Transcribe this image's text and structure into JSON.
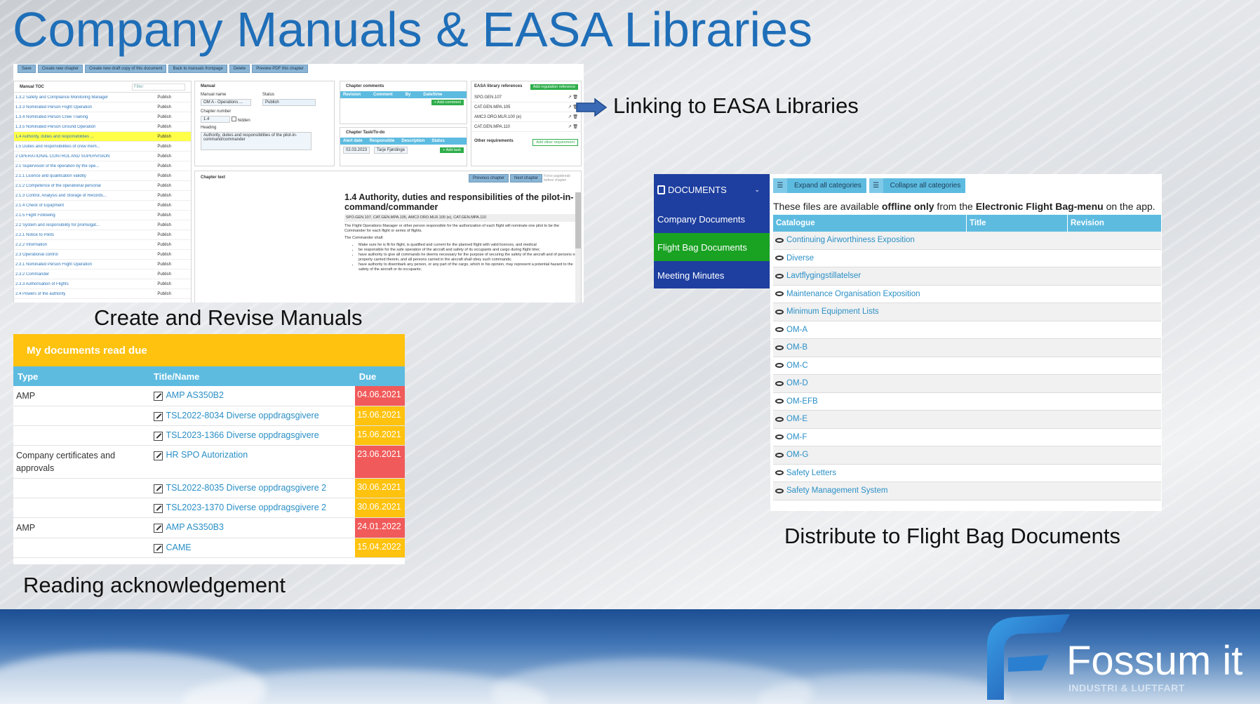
{
  "page": {
    "title": "Company Manuals & EASA Libraries",
    "captions": {
      "linking": "Linking to EASA Libraries",
      "create": "Create and Revise Manuals",
      "distribute": "Distribute to Flight Bag Documents",
      "reading": "Reading acknowledgement"
    }
  },
  "editor": {
    "toolbar": [
      "Save",
      "Create new chapter",
      "Create new draft copy of this document",
      "Back to manuals frontpage",
      "Delete",
      "Preview PDF this chapter"
    ],
    "toc": {
      "title": "Manual TOC",
      "filter": "Filter",
      "rows": [
        {
          "t": "1.3.2 Safety and Compliance Monitoring Manager",
          "s": "Publish"
        },
        {
          "t": "1.3.3 Nominated Person Flight Operation",
          "s": "Publish"
        },
        {
          "t": "1.3.4 Nominated Person Crew Training",
          "s": "Publish"
        },
        {
          "t": "1.3.5 Nominated Person Ground Operation",
          "s": "Publish"
        },
        {
          "t": "1.4 Authority, duties and responsibilities ...",
          "s": "Publish"
        },
        {
          "t": "1.5 Duties and responsibilities of crew mem...",
          "s": "Publish"
        },
        {
          "t": "2 OPERATIONAL CONTROL AND SUPERVISION",
          "s": "Publish"
        },
        {
          "t": "2.1 Supervision of the operation by the ope...",
          "s": "Publish"
        },
        {
          "t": "2.1.1 Licence and qualification validity",
          "s": "Publish"
        },
        {
          "t": "2.1.2 Competence of the operational personal",
          "s": "Publish"
        },
        {
          "t": "2.1.3 Control, Analysis and Storage of Records...",
          "s": "Publish"
        },
        {
          "t": "2.1.4 Check of Equipment",
          "s": "Publish"
        },
        {
          "t": "2.1.5 Flight Following",
          "s": "Publish"
        },
        {
          "t": "2.2 System and responsibility for promulgat...",
          "s": "Publish"
        },
        {
          "t": "2.2.1 Notice to Pilots",
          "s": "Publish"
        },
        {
          "t": "2.2.2 Information",
          "s": "Publish"
        },
        {
          "t": "2.3 Operational control",
          "s": "Publish"
        },
        {
          "t": "2.3.1 Nominated Person Flight Operation",
          "s": "Publish"
        },
        {
          "t": "2.3.2 Commander",
          "s": "Publish"
        },
        {
          "t": "2.3.3 Authorisation of Flights",
          "s": "Publish"
        },
        {
          "t": "2.4 Powers of the authority",
          "s": "Publish"
        }
      ]
    },
    "manual": {
      "title": "Manual",
      "name_label": "Manual name",
      "name_value": "OM A - Operations ...",
      "status_label": "Status",
      "status_value": "Publish",
      "chapter_label": "Chapter number",
      "chapter_value": "1.4",
      "hidden_label": "hidden",
      "heading_label": "Heading",
      "heading_value": "Authority, duties and responsibilities of the pilot-in-command/commander"
    },
    "comments": {
      "title": "Chapter comments",
      "cols": [
        "Revision",
        "Comment",
        "By",
        "Date/time"
      ],
      "add": "+ Add comment"
    },
    "tasks": {
      "title": "Chapter Task/To-do",
      "cols": [
        "Alert date",
        "Responsible",
        "Description",
        "Status"
      ],
      "date": "02.03.2023",
      "person": "Tarje Fjørdinge",
      "add": "+ Add task"
    },
    "easa": {
      "title": "EASA library references",
      "add": "Add regulation reference",
      "refs": [
        "SPO.GEN.107",
        "CAT.GEN.MPA.105",
        "AMC3 ORO.MLR.100 (e)",
        "CAT.GEN.MPA.110"
      ],
      "other_title": "Other requirements",
      "other_add": "Add other requirement"
    },
    "chapter_text": {
      "label": "Chapter text",
      "prev": "Previous chapter",
      "next": "Next chapter",
      "pagebreak": "Force pagebreak before chapter",
      "heading": "1.4 Authority, duties and responsibilities of the pilot-in-command/commander",
      "refs_line": "SPO.GEN.107, CAT.GEN.MPA.105, AMC3 ORO.MLR.100 (e), CAT.GEN.MPA.110",
      "p1": "The Flight Operations Manager or other person responsible for the authorization of each flight will nominate one pilot to be the Commander for each flight or series of flights.",
      "p2": "The Commander shall:",
      "bullets": [
        "Make sure he is fit for flight, is qualified and current for the planned flight with valid licences, and medical",
        "be responsible for the safe operation of the aircraft and safety of its occupants and cargo during flight time;",
        "have authority to give all commands he deems necessary for the purpose of securing the safety of the aircraft and of persons or property carried therein, and all persons carried in the aircraft shall obey such commands;",
        "have authority to disembark any person, or any part of the cargo, which in his opinion, may represent a potential hazard to the safety of the aircraft or its occupants;"
      ]
    }
  },
  "reading": {
    "header": "My documents read due",
    "cols": [
      "Type",
      "Title/Name",
      "Due"
    ],
    "rows": [
      {
        "type": "AMP",
        "title": "AMP AS350B2",
        "due": "04.06.2021",
        "color": "#f15a5a"
      },
      {
        "type": "",
        "title": "TSL2022-8034 Diverse oppdragsgivere",
        "due": "15.06.2021",
        "color": "#ffc20e"
      },
      {
        "type": "",
        "title": "TSL2023-1366 Diverse oppdragsgivere",
        "due": "15.06.2021",
        "color": "#ffc20e"
      },
      {
        "type": "Company certificates and approvals",
        "title": "HR SPO Autorization",
        "due": "23.06.2021",
        "color": "#f15a5a"
      },
      {
        "type": "",
        "title": "TSL2022-8035 Diverse oppdragsgivere 2",
        "due": "30.06.2021",
        "color": "#ffc20e"
      },
      {
        "type": "",
        "title": "TSL2023-1370 Diverse oppdragsgivere 2",
        "due": "30.06.2021",
        "color": "#ffc20e"
      },
      {
        "type": "AMP",
        "title": "AMP AS350B3",
        "due": "24.01.2022",
        "color": "#f15a5a"
      },
      {
        "type": "",
        "title": "CAME",
        "due": "15.04.2022",
        "color": "#ffc20e"
      }
    ]
  },
  "documents": {
    "nav": {
      "header": "DOCUMENTS",
      "items": [
        "Company Documents",
        "Flight Bag Documents",
        "Meeting Minutes"
      ]
    },
    "expand": "Expand all categories",
    "collapse": "Collapse all categories",
    "info_pre": "These files are available ",
    "info_bold1": "offline only",
    "info_mid": " from the ",
    "info_bold2": "Electronic Flight Bag-menu",
    "info_post": " on the app.",
    "cols": [
      "Catalogue",
      "Title",
      "Revision"
    ],
    "rows": [
      "Continuing Airworthiness Exposition",
      "Diverse",
      "Lavtflygingstillatelser",
      "Maintenance Organisation Exposition",
      "Minimum Equipment Lists",
      "OM-A",
      "OM-B",
      "OM-C",
      "OM-D",
      "OM-EFB",
      "OM-E",
      "OM-F",
      "OM-G",
      "Safety Letters",
      "Safety Management System"
    ]
  },
  "logo": {
    "name": "Fossum it",
    "tagline": "INDUSTRI & LUFTFART"
  }
}
